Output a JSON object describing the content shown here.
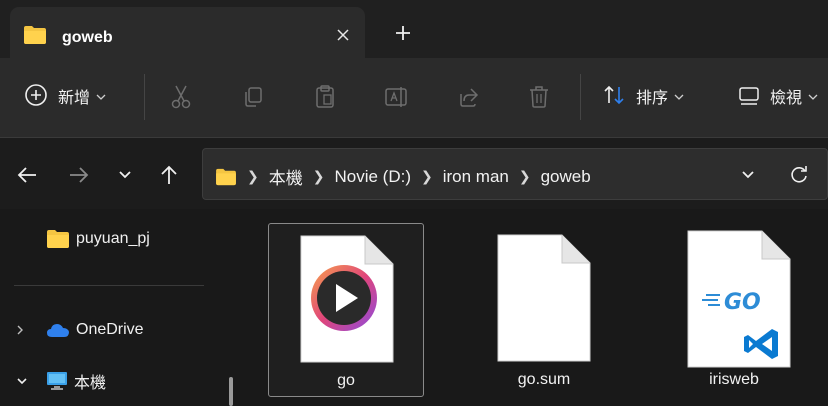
{
  "tab": {
    "title": "goweb"
  },
  "toolbar": {
    "new_label": "新增",
    "sort_label": "排序",
    "view_label": "檢視"
  },
  "address": {
    "crumbs": [
      "本機",
      "Novie (D:)",
      "iron man",
      "goweb"
    ]
  },
  "sidebar": {
    "items": [
      {
        "label": "puyuan_pj",
        "icon": "folder-icon"
      },
      {
        "label": "OneDrive",
        "icon": "cloud-icon"
      },
      {
        "label": "本機",
        "icon": "monitor-icon"
      }
    ]
  },
  "files": [
    {
      "name": "go",
      "icon": "media-player-icon",
      "selected": true
    },
    {
      "name": "go.sum",
      "icon": "blank-file-icon",
      "selected": false
    },
    {
      "name": "irisweb",
      "icon": "go-vscode-file-icon",
      "selected": false
    }
  ],
  "colors": {
    "folder": "#f4c542",
    "accent_blue": "#2f80ed",
    "go_blue": "#2d8cd6",
    "vscode_blue": "#0a7ad1"
  }
}
